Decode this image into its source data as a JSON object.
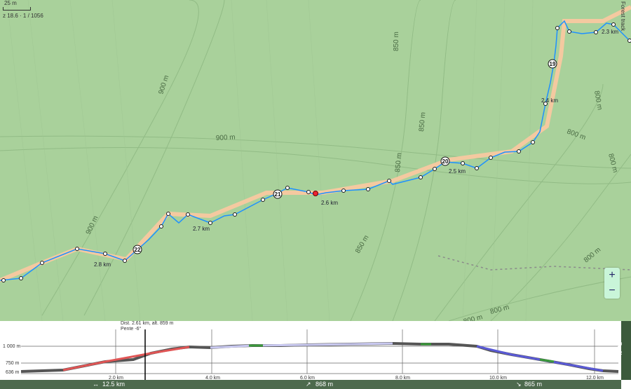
{
  "map": {
    "scale_label": "25 m",
    "zoom_info": "z 18.6 · 1 / 1056",
    "road_label": "Forest track",
    "contour_labels": [
      "900 m",
      "900 m",
      "900 m",
      "850 m",
      "850 m",
      "850 m",
      "850 m",
      "800 m",
      "800 m",
      "800 m",
      "800 m",
      "800 m",
      "800 m"
    ],
    "waypoints": [
      "19",
      "20",
      "21",
      "22"
    ],
    "distance_labels": [
      "2.3 km",
      "2.4 km",
      "2.5 km",
      "2.6 km",
      "2.7 km",
      "2.8 km"
    ],
    "zoom_in": "+",
    "zoom_out": "−"
  },
  "profile": {
    "cursor_info_line1": "Dist. 2.61 km, alt. 859 m",
    "cursor_info_line2": "Pente -6°",
    "y_labels": [
      "1 000 m",
      "750 m",
      "636 m"
    ],
    "x_labels": [
      "2.0 km",
      "4.0 km",
      "6.0 km",
      "8.0 km",
      "10.0 km",
      "12.0 km"
    ],
    "side_label": "Profil"
  },
  "status": {
    "distance": "12.5 km",
    "ascent": "868 m",
    "descent": "865 m"
  },
  "colors": {
    "route": "#1e90ff",
    "terrain": "#a9d19b",
    "track": "#f4c9a0"
  }
}
